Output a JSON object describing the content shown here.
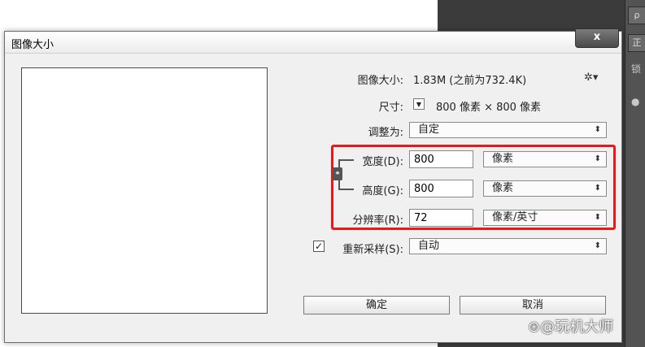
{
  "dialog": {
    "title": "图像大小",
    "close_label": "x"
  },
  "info": {
    "image_size_label": "图像大小:",
    "image_size_value": "1.83M (之前为732.4K)",
    "dimensions_label": "尺寸:",
    "dimensions_value": "800 像素 × 800 像素",
    "fit_to_label": "调整为:",
    "fit_to_value": "自定"
  },
  "fields": {
    "width_label": "宽度(D):",
    "width_value": "800",
    "width_unit": "像素",
    "height_label": "高度(G):",
    "height_value": "800",
    "height_unit": "像素",
    "resolution_label": "分辨率(R):",
    "resolution_value": "72",
    "resolution_unit": "像素/英寸"
  },
  "resample": {
    "checked": true,
    "label": "重新采样(S):",
    "value": "自动"
  },
  "buttons": {
    "ok": "确定",
    "cancel": "取消"
  },
  "background_panel": {
    "item1": "ρ",
    "item2": "正",
    "item3": "锁",
    "item4": "●"
  },
  "watermark": "⊛@玩机大师",
  "icons": {
    "gear": "gear-icon",
    "chain": "chain-link-icon",
    "dropdown": "chevron-updown-icon"
  },
  "colors": {
    "highlight": "#e8191c",
    "dialog_bg": "#f0f0f0",
    "dark_bg": "#3b3b3b"
  }
}
